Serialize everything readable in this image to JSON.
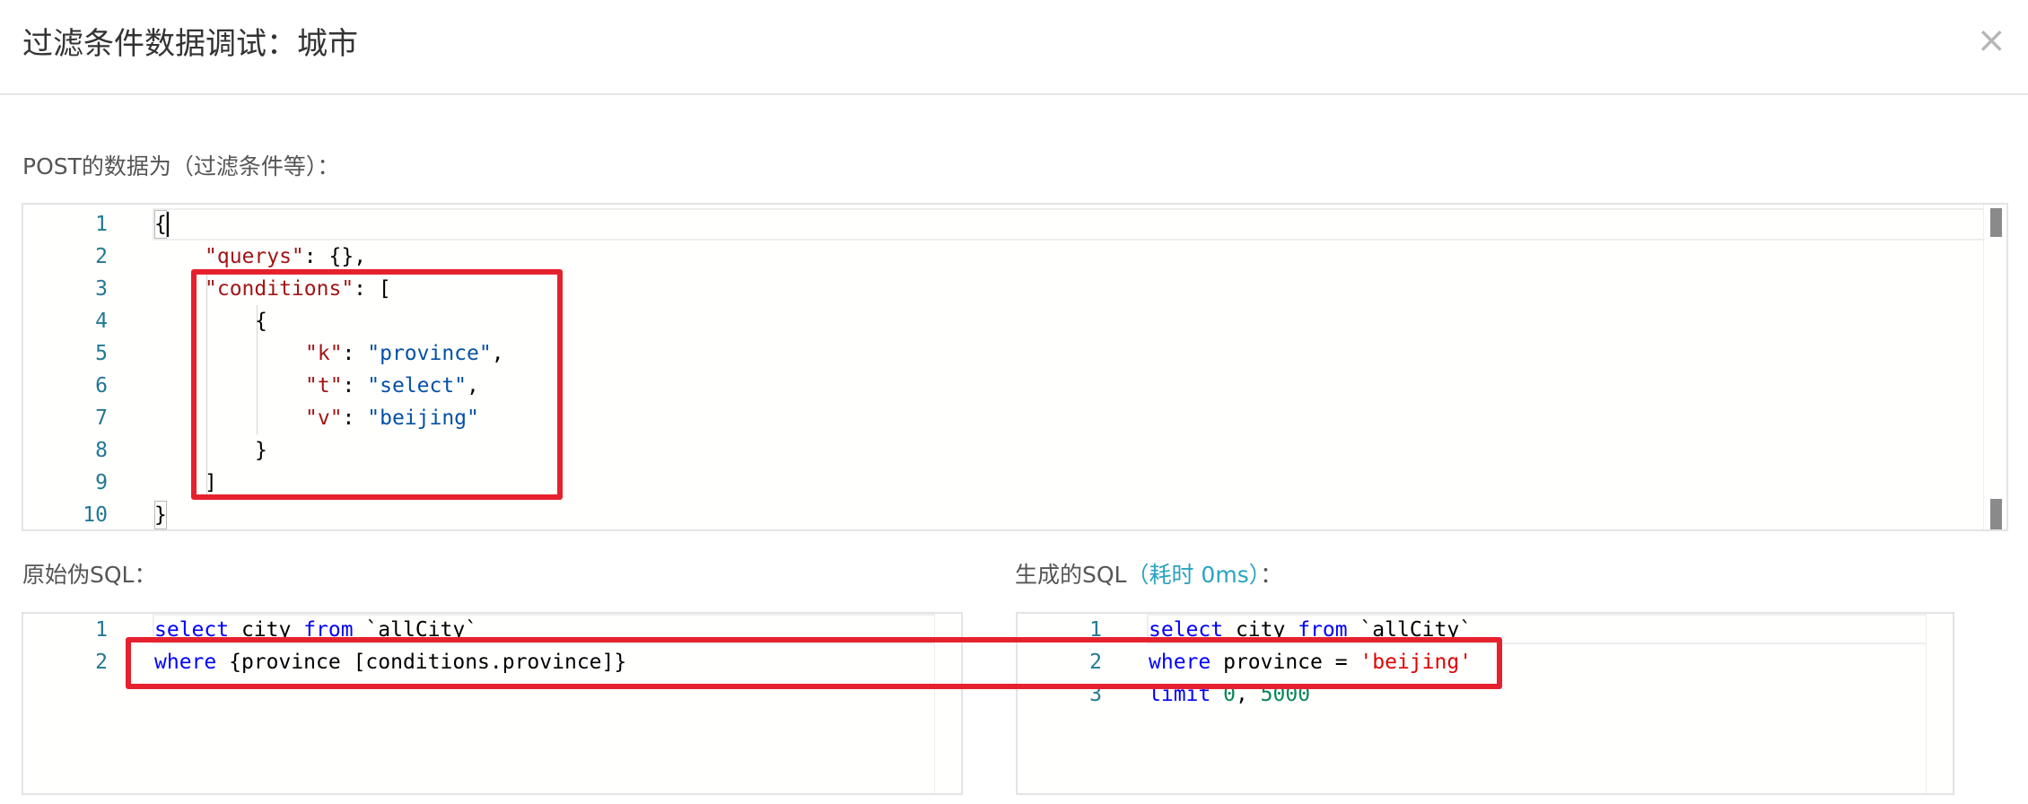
{
  "dialog": {
    "title": "过滤条件数据调试：城市",
    "close_icon": "×"
  },
  "post_section": {
    "label": "POST的数据为（过滤条件等）：",
    "line_numbers": [
      "1",
      "2",
      "3",
      "4",
      "5",
      "6",
      "7",
      "8",
      "9",
      "10"
    ],
    "lines": [
      "{",
      "\"querys\": {},",
      "\"conditions\": [",
      "{",
      "\"k\": \"province\",",
      "\"t\": \"select\",",
      "\"v\": \"beijing\"",
      "}",
      "]",
      "}"
    ]
  },
  "raw_sql": {
    "label": "原始伪SQL：",
    "line_numbers": [
      "1",
      "2"
    ],
    "lines": [
      "select city from `allCity`",
      "where {province [conditions.province]}"
    ]
  },
  "generated_sql": {
    "label_prefix": "生成的SQL",
    "label_time": "（耗时 0ms）",
    "label_suffix": "：",
    "line_numbers": [
      "1",
      "2",
      "3"
    ],
    "lines": [
      "select city from `allCity`",
      "where province = 'beijing'",
      "limit 0, 5000"
    ]
  },
  "colors": {
    "keyword": "#0000ff",
    "json_key": "#a31515",
    "json_value": "#0451a5",
    "sql_string": "#e00000",
    "number": "#098658",
    "line_number": "#237893",
    "accent": "#2aa3bf",
    "annotation": "#e6212e"
  }
}
